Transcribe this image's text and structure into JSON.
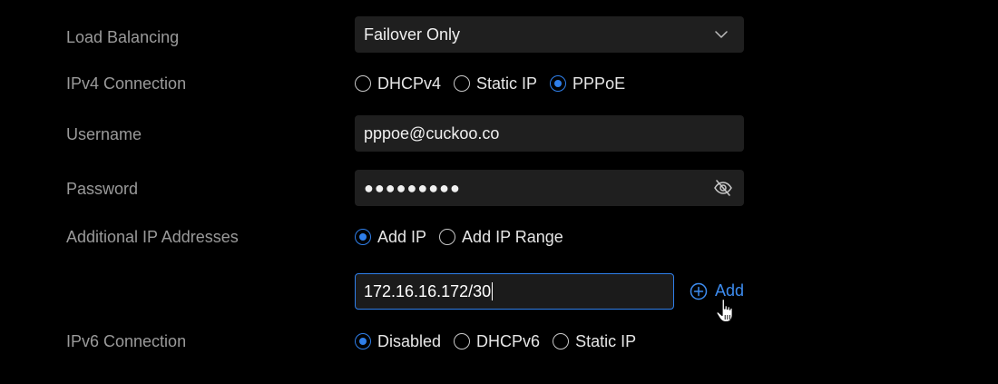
{
  "load_balancing": {
    "label": "Load Balancing",
    "selected": "Failover Only",
    "icon": "chevron-down-icon"
  },
  "ipv4": {
    "label": "IPv4 Connection",
    "options": [
      {
        "label": "DHCPv4",
        "selected": false
      },
      {
        "label": "Static IP",
        "selected": false
      },
      {
        "label": "PPPoE",
        "selected": true
      }
    ]
  },
  "username": {
    "label": "Username",
    "value": "pppoe@cuckoo.co"
  },
  "password": {
    "label": "Password",
    "value": "●●●●●●●●●",
    "icon": "eye-off-icon"
  },
  "additional_ip": {
    "label": "Additional IP Addresses",
    "options": [
      {
        "label": "Add IP",
        "selected": true
      },
      {
        "label": "Add IP Range",
        "selected": false
      }
    ],
    "input_value": "172.16.16.172/30",
    "add_label": "Add",
    "add_icon": "plus-circle-icon"
  },
  "ipv6": {
    "label": "IPv6 Connection",
    "options": [
      {
        "label": "Disabled",
        "selected": true
      },
      {
        "label": "DHCPv6",
        "selected": false
      },
      {
        "label": "Static IP",
        "selected": false
      }
    ]
  },
  "colors": {
    "accent": "#2f7fea",
    "field_bg": "#1f1f1f",
    "label_text": "#9a9a9a",
    "background": "#000000"
  }
}
